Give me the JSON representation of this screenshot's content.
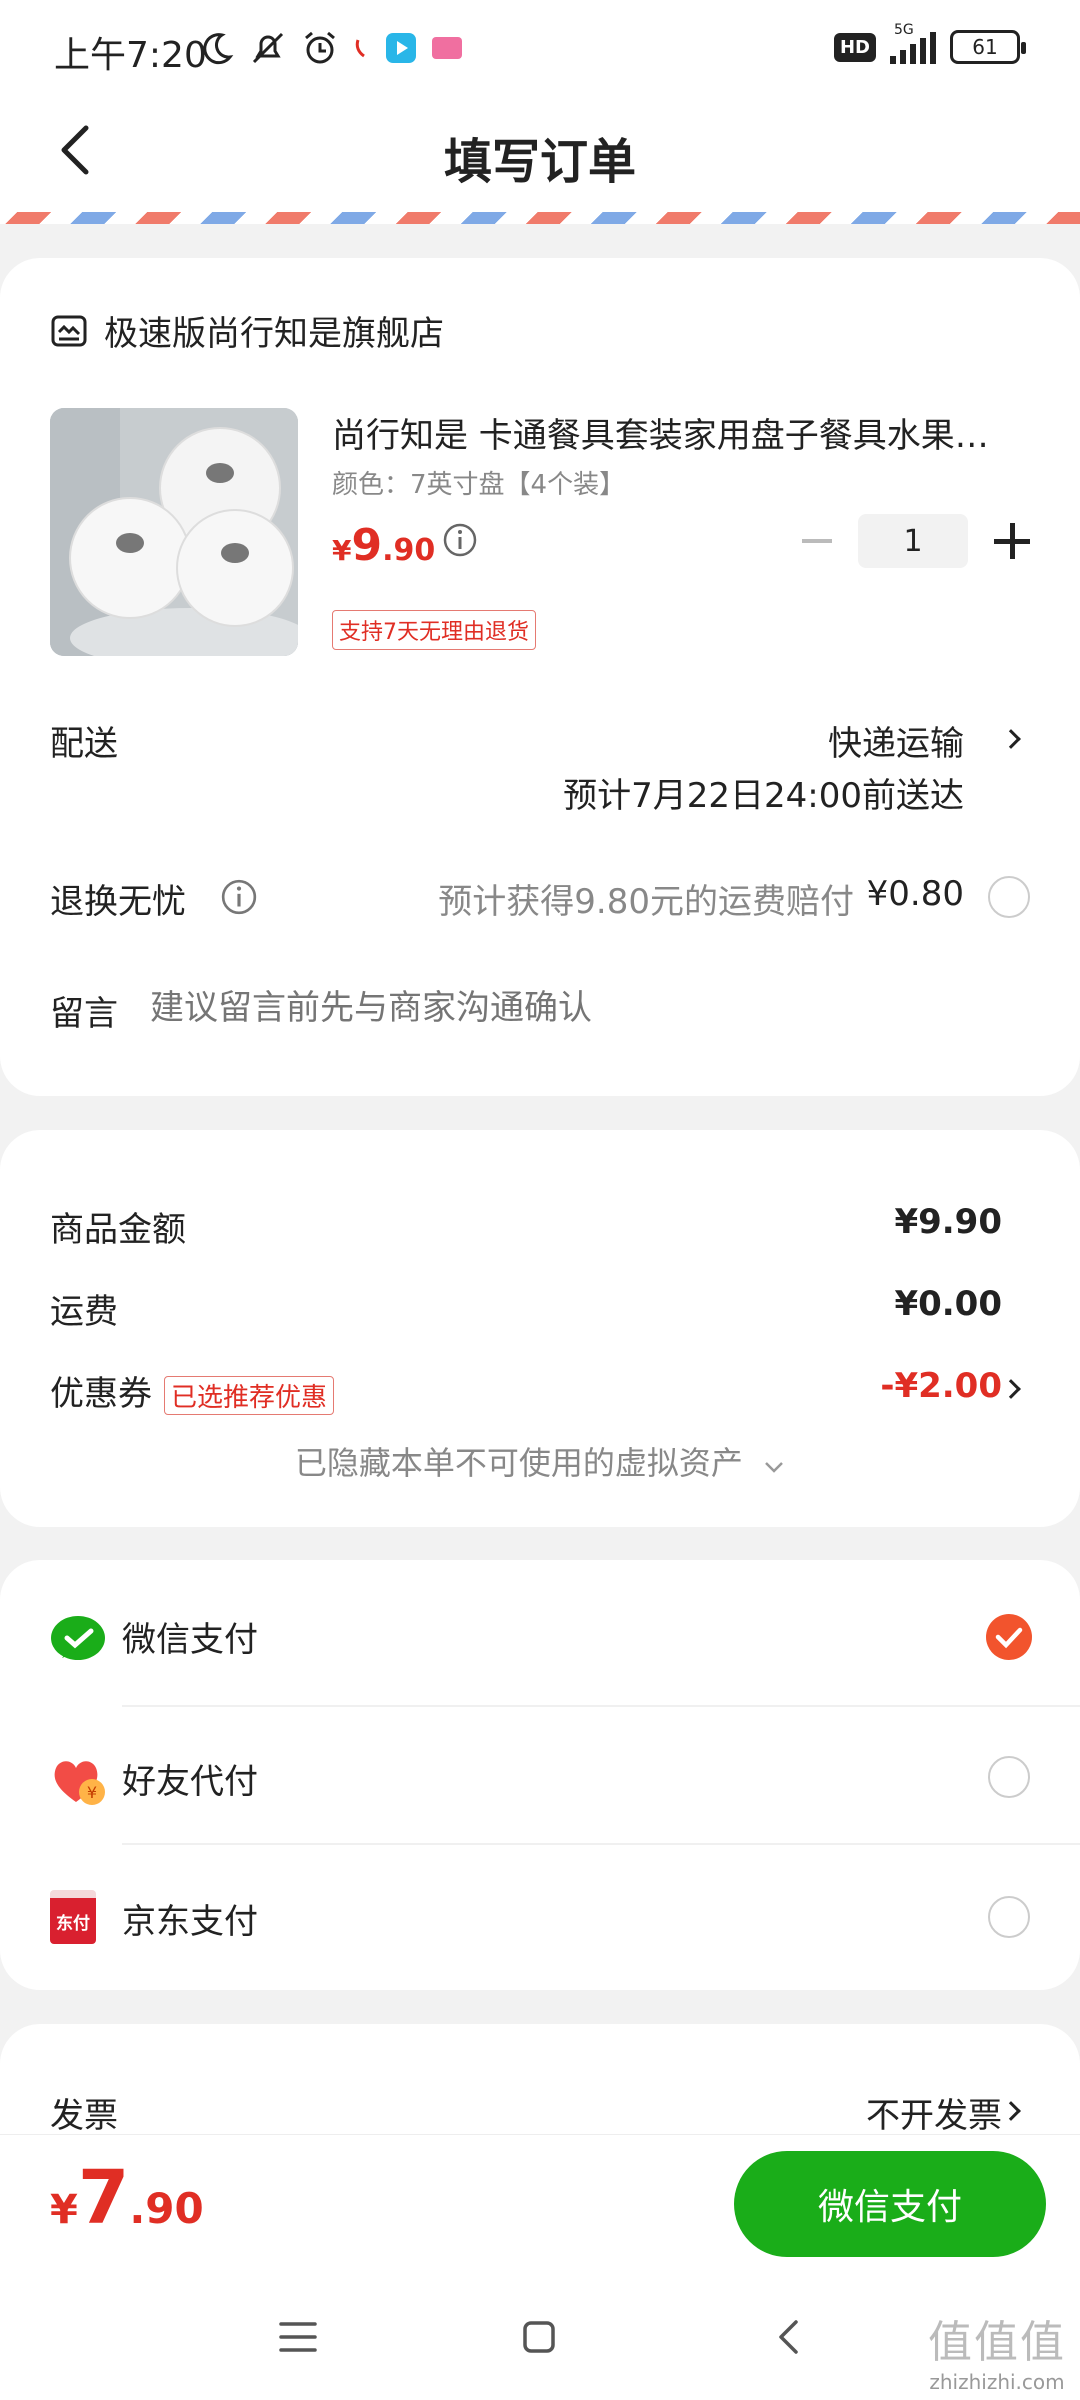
{
  "status_bar": {
    "time": "上午7:20",
    "network": "5G",
    "battery": "61",
    "hd": "HD"
  },
  "nav": {
    "title": "填写订单"
  },
  "shop": {
    "name": "极速版尚行知是旗舰店"
  },
  "product": {
    "title": "尚行知是 卡通餐具套装家用盘子餐具水果…",
    "spec": "颜色：7英寸盘【4个装】",
    "price_currency": "¥",
    "price_int": "9",
    "price_dec": ".90",
    "quantity": "1",
    "return_tag": "支持7天无理由退货"
  },
  "delivery": {
    "label": "配送",
    "method": "快递运输",
    "estimate": "预计7月22日24:00前送达"
  },
  "return_insurance": {
    "label": "退换无忧",
    "desc": "预计获得9.80元的运费赔付",
    "price": "¥0.80"
  },
  "message": {
    "label": "留言",
    "placeholder": "建议留言前先与商家沟通确认"
  },
  "summary": {
    "goods_label": "商品金额",
    "goods_value": "¥9.90",
    "shipping_label": "运费",
    "shipping_value": "¥0.00",
    "coupon_label": "优惠券",
    "coupon_tag": "已选推荐优惠",
    "coupon_value": "-¥2.00",
    "hidden_assets": "已隐藏本单不可使用的虚拟资产"
  },
  "payment_methods": [
    {
      "label": "微信支付",
      "icon": "wechat-pay-icon",
      "selected": true
    },
    {
      "label": "好友代付",
      "icon": "friend-pay-icon",
      "selected": false
    },
    {
      "label": "京东支付",
      "icon": "jd-pay-icon",
      "selected": false,
      "icon_text": "东付"
    }
  ],
  "invoice": {
    "label": "发票",
    "value": "不开发票"
  },
  "bottom": {
    "total_currency": "¥",
    "total_int": "7",
    "total_dec": ".90",
    "pay_button": "微信支付"
  },
  "watermark": {
    "main": "值值值",
    "sub": "zhizhizhi.com"
  },
  "colors": {
    "accent_green": "#1aad19",
    "price_red": "#e02e24",
    "radio_selected": "#f2542d"
  }
}
